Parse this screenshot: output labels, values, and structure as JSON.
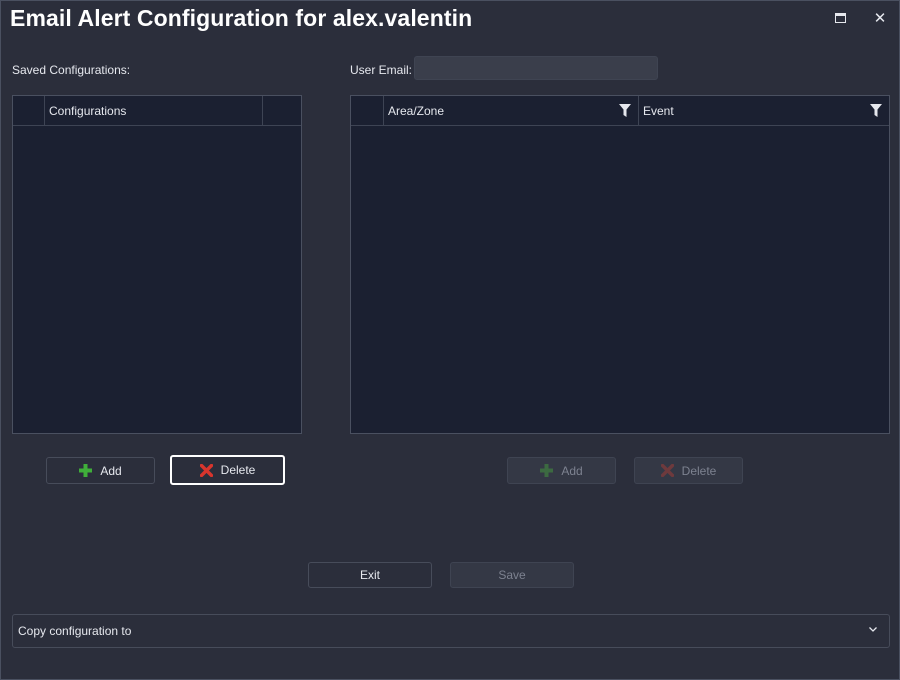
{
  "window": {
    "title": "Email Alert Configuration for alex.valentin",
    "maximize_icon": "maximize-icon",
    "close_glyph": "✕"
  },
  "left": {
    "label": "Saved Configurations:",
    "grid": {
      "columns": [
        "",
        "Configurations",
        ""
      ],
      "rows": []
    },
    "add_label": "Add",
    "delete_label": "Delete"
  },
  "right": {
    "email_label": "User Email:",
    "email_value": "",
    "grid": {
      "columns": [
        "",
        "Area/Zone",
        "Event"
      ],
      "rows": []
    },
    "add_label": "Add",
    "delete_label": "Delete"
  },
  "footer": {
    "exit_label": "Exit",
    "save_label": "Save",
    "copy_placeholder": "Copy configuration to"
  },
  "colors": {
    "add_icon": "#3fae3a",
    "delete_icon": "#d8352d",
    "add_icon_disabled": "#3c6a41",
    "delete_icon_disabled": "#6e3a3d"
  }
}
